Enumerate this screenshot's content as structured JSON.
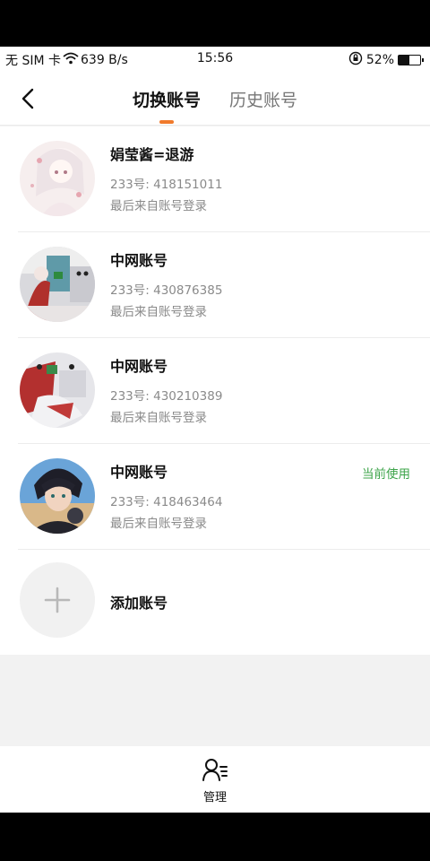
{
  "status_bar": {
    "carrier": "无 SIM 卡",
    "net_speed": "639 B/s",
    "time": "15:56",
    "battery": "52%",
    "battery_level": 0.52
  },
  "header": {
    "tabs": [
      {
        "label": "切换账号",
        "active": true
      },
      {
        "label": "历史账号",
        "active": false
      }
    ],
    "accent_color": "#f07a2c"
  },
  "accounts": [
    {
      "name": "娟莹酱=退游",
      "uid": "233号: 418151011",
      "last_login": "最后来自账号登录",
      "current": ""
    },
    {
      "name": "中网账号",
      "uid": "233号: 430876385",
      "last_login": "最后来自账号登录",
      "current": ""
    },
    {
      "name": "中网账号",
      "uid": "233号: 430210389",
      "last_login": "最后来自账号登录",
      "current": ""
    },
    {
      "name": "中网账号",
      "uid": "233号: 418463464",
      "last_login": "最后来自账号登录",
      "current": "当前使用"
    }
  ],
  "add_account": {
    "label": "添加账号",
    "icon": "plus-icon"
  },
  "bottom_bar": {
    "manage_label": "管理",
    "icon": "user-list-icon"
  },
  "colors": {
    "current_status": "#3da44a"
  }
}
